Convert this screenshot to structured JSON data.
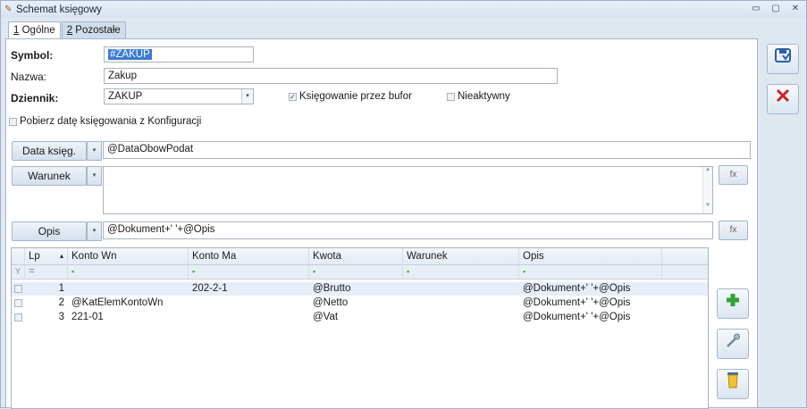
{
  "window": {
    "title": "Schemat księgowy",
    "controls": [
      "▭",
      "▢",
      "✕"
    ]
  },
  "tabs": [
    {
      "num": "1",
      "label": " Ogólne"
    },
    {
      "num": "2",
      "label": " Pozostałe"
    }
  ],
  "form": {
    "symbol_label": "Symbol:",
    "symbol_value": "#ZAKUP",
    "nazwa_label": "Nazwa:",
    "nazwa_value": "Zakup",
    "dziennik_label": "Dziennik:",
    "dziennik_value": "ZAKUP",
    "ksiegowanie_label": "Księgowanie przez bufor",
    "ksiegowanie_checked": true,
    "nieaktywny_label": "Nieaktywny",
    "pobierz_label": "Pobierz datę księgowania z Konfiguracji",
    "data_ksieg_button": "Data księg.",
    "data_ksieg_value": "@DataObowPodat",
    "warunek_button": "Warunek",
    "warunek_value": "",
    "opis_button": "Opis",
    "opis_value": "@Dokument+' '+@Opis"
  },
  "grid": {
    "columns": [
      "Lp",
      "Konto Wn",
      "Konto Ma",
      "Kwota",
      "Warunek",
      "Opis"
    ],
    "rows": [
      {
        "lp": "1",
        "konto_wn": "",
        "konto_ma": "202-2-1",
        "kwota": "@Brutto",
        "warunek": "",
        "opis": "@Dokument+' '+@Opis"
      },
      {
        "lp": "2",
        "konto_wn": "@KatElemKontoWn",
        "konto_ma": "",
        "kwota": "@Netto",
        "warunek": "",
        "opis": "@Dokument+' '+@Opis"
      },
      {
        "lp": "3",
        "konto_wn": "221-01",
        "konto_ma": "",
        "kwota": "@Vat",
        "warunek": "",
        "opis": "@Dokument+' '+@Opis"
      }
    ]
  },
  "icons": {
    "save": "save-icon",
    "cancel": "cancel-icon",
    "add": "plus-icon",
    "edit": "edit-icon",
    "delete": "trash-icon"
  },
  "colors": {
    "save_icon": "#2d5fa8",
    "cancel_icon": "#d0202a",
    "add_icon": "#2fa336",
    "delete_icon": "#f2c12e"
  }
}
